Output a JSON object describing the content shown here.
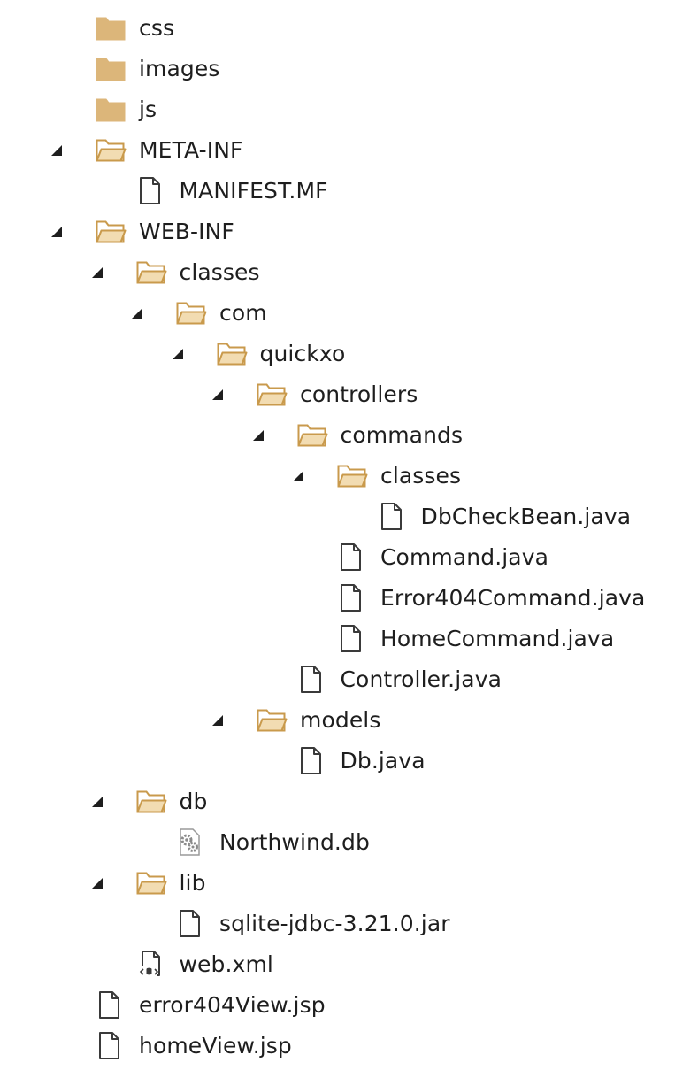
{
  "colors": {
    "folder_fill": "#dcb67a",
    "folder_open_fill": "#f2dcb2",
    "folder_stroke": "#c99a4c",
    "file_stroke": "#3a3a3a",
    "expander_fill": "#1e1e1e",
    "text": "#1e1e1e"
  },
  "tree": {
    "items": [
      {
        "label": "css",
        "depth": 0,
        "icon": "folder-closed-icon",
        "expanded": false,
        "has_children": true
      },
      {
        "label": "images",
        "depth": 0,
        "icon": "folder-closed-icon",
        "expanded": false,
        "has_children": true
      },
      {
        "label": "js",
        "depth": 0,
        "icon": "folder-closed-icon",
        "expanded": false,
        "has_children": true
      },
      {
        "label": "META-INF",
        "depth": 0,
        "icon": "folder-open-icon",
        "expanded": true,
        "has_children": true
      },
      {
        "label": "MANIFEST.MF",
        "depth": 1,
        "icon": "file-icon",
        "expanded": false,
        "has_children": false
      },
      {
        "label": "WEB-INF",
        "depth": 0,
        "icon": "folder-open-icon",
        "expanded": true,
        "has_children": true
      },
      {
        "label": "classes",
        "depth": 1,
        "icon": "folder-open-icon",
        "expanded": true,
        "has_children": true
      },
      {
        "label": "com",
        "depth": 2,
        "icon": "folder-open-icon",
        "expanded": true,
        "has_children": true
      },
      {
        "label": "quickxo",
        "depth": 3,
        "icon": "folder-open-icon",
        "expanded": true,
        "has_children": true
      },
      {
        "label": "controllers",
        "depth": 4,
        "icon": "folder-open-icon",
        "expanded": true,
        "has_children": true
      },
      {
        "label": "commands",
        "depth": 5,
        "icon": "folder-open-icon",
        "expanded": true,
        "has_children": true
      },
      {
        "label": "classes",
        "depth": 6,
        "icon": "folder-open-icon",
        "expanded": true,
        "has_children": true
      },
      {
        "label": "DbCheckBean.java",
        "depth": 7,
        "icon": "file-icon",
        "expanded": false,
        "has_children": false
      },
      {
        "label": "Command.java",
        "depth": 6,
        "icon": "file-icon",
        "expanded": false,
        "has_children": false
      },
      {
        "label": "Error404Command.java",
        "depth": 6,
        "icon": "file-icon",
        "expanded": false,
        "has_children": false
      },
      {
        "label": "HomeCommand.java",
        "depth": 6,
        "icon": "file-icon",
        "expanded": false,
        "has_children": false
      },
      {
        "label": "Controller.java",
        "depth": 5,
        "icon": "file-icon",
        "expanded": false,
        "has_children": false
      },
      {
        "label": "models",
        "depth": 4,
        "icon": "folder-open-icon",
        "expanded": true,
        "has_children": true
      },
      {
        "label": "Db.java",
        "depth": 5,
        "icon": "file-icon",
        "expanded": false,
        "has_children": false
      },
      {
        "label": "db",
        "depth": 1,
        "icon": "folder-open-icon",
        "expanded": true,
        "has_children": true
      },
      {
        "label": "Northwind.db",
        "depth": 2,
        "icon": "settings-file-icon",
        "expanded": false,
        "has_children": false
      },
      {
        "label": "lib",
        "depth": 1,
        "icon": "folder-open-icon",
        "expanded": true,
        "has_children": true
      },
      {
        "label": "sqlite-jdbc-3.21.0.jar",
        "depth": 2,
        "icon": "file-icon",
        "expanded": false,
        "has_children": false
      },
      {
        "label": "web.xml",
        "depth": 1,
        "icon": "xml-config-file-icon",
        "expanded": false,
        "has_children": false
      },
      {
        "label": "error404View.jsp",
        "depth": 0,
        "icon": "file-icon",
        "expanded": false,
        "has_children": false
      },
      {
        "label": "homeView.jsp",
        "depth": 0,
        "icon": "file-icon",
        "expanded": false,
        "has_children": false
      }
    ]
  }
}
